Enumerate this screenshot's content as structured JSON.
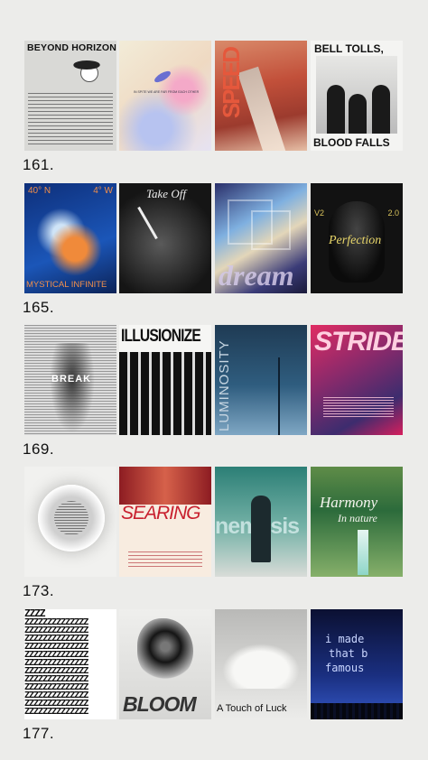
{
  "rows": [
    {
      "number": "161.",
      "posters": [
        {
          "title": "BEYOND HORIZONS"
        },
        {
          "caption": "IN SPITE WE ARE FAR FROM EACH OTHER"
        },
        {
          "title": "SPEED"
        },
        {
          "title_top": "BELL TOLLS,",
          "title_bottom": "BLOOD FALLS"
        }
      ]
    },
    {
      "number": "165.",
      "posters": [
        {
          "top_left": "40° N",
          "top_right": "4° W",
          "title": "MYSTICAL INFINITE"
        },
        {
          "title": "Take Off"
        },
        {
          "title": "dream"
        },
        {
          "title": "Perfection",
          "left_tag": "V2",
          "right_tag": "2.0"
        }
      ]
    },
    {
      "number": "169.",
      "posters": [
        {
          "title": "BREAK"
        },
        {
          "title": "ILLUSIONIZE"
        },
        {
          "title": "LUMINOSITY"
        },
        {
          "title": "STRIDE"
        }
      ]
    },
    {
      "number": "173.",
      "posters": [
        {
          "title": ""
        },
        {
          "title": "SEARING"
        },
        {
          "title": "nemesis"
        },
        {
          "title_line1": "Harmony",
          "title_line2": "In nature"
        }
      ]
    },
    {
      "number": "177.",
      "posters": [
        {
          "title": "ZZZZ"
        },
        {
          "title": "BLOOM"
        },
        {
          "title": "A Touch of Luck"
        },
        {
          "title_line1": "i made",
          "title_line2": "that b",
          "title_line3": "famous"
        }
      ]
    }
  ]
}
